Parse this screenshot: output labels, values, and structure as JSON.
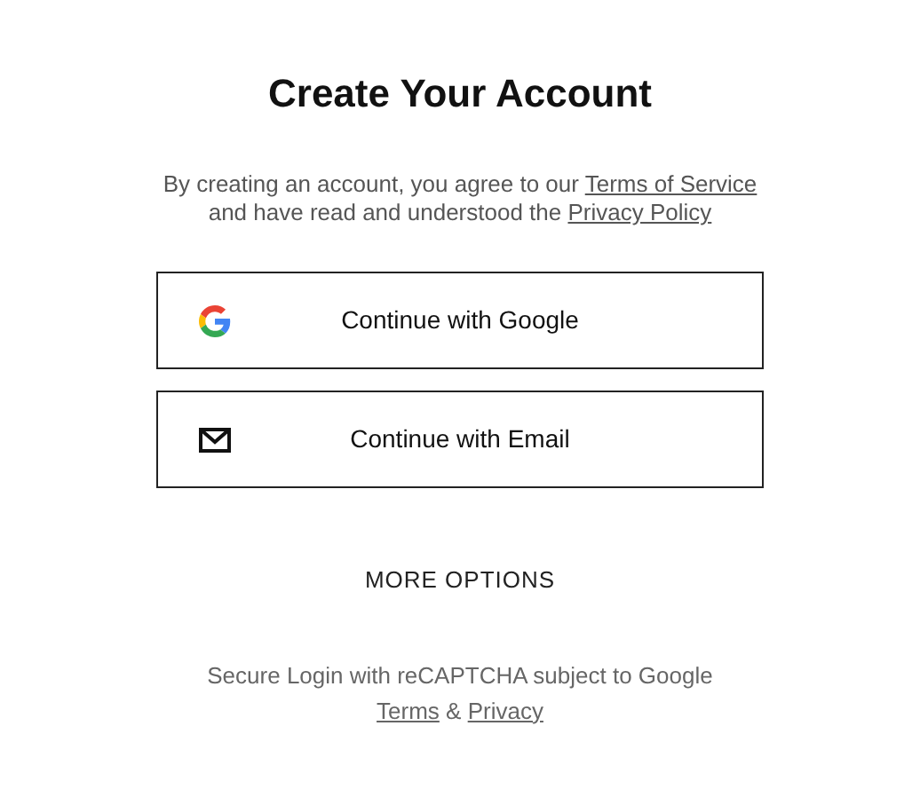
{
  "title": "Create Your Account",
  "intro": [
    {
      "kind": "text",
      "text": "By creating an account, you agree to our "
    },
    {
      "kind": "link",
      "text": "Terms of Service"
    },
    {
      "kind": "text",
      "text": " and have read and understood the "
    },
    {
      "kind": "link",
      "text": "Privacy Policy"
    }
  ],
  "buttons": [
    {
      "kind": "google",
      "label": "Continue with Google"
    },
    {
      "kind": "email",
      "label": "Continue with Email"
    }
  ],
  "more_options": "MORE OPTIONS",
  "footer": [
    {
      "kind": "text",
      "text": "Secure Login with reCAPTCHA subject to Google "
    },
    {
      "kind": "link",
      "text": "Terms"
    },
    {
      "kind": "text",
      "text": " & "
    },
    {
      "kind": "link",
      "text": "Privacy"
    }
  ]
}
